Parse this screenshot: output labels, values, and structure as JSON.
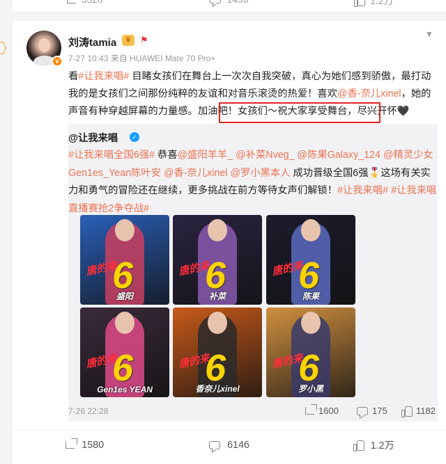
{
  "top_strip": {
    "actions": [
      {
        "icon": "share-icon",
        "count": "5320"
      },
      {
        "icon": "comment-icon",
        "count": "1496"
      },
      {
        "icon": "like-icon",
        "count": "1.2万"
      }
    ]
  },
  "post": {
    "username": "刘涛tamia",
    "meta": "7-27 10:43 来自 HUAWEI Mate 70 Pro+",
    "text_parts": {
      "p1": "看",
      "tag1": "#让我来唱#",
      "p2": " 目睹女孩们在舞台上一次次自我突破，真心为她们感到骄傲，最打动我的是女孩们之间那份纯粹的友谊和对音乐滚烫的热爱！喜欢",
      "mention1": "@香-奈儿xinel",
      "p3": "，她的声音有种穿越屏幕的力量感。",
      "p4": "加油吧！女孩们～祝大家享受舞台，尽兴开怀🖤"
    },
    "highlight_color": "#e02424"
  },
  "repost": {
    "author": "@让我来唱",
    "text_parts": {
      "tag1": "#让我来唱全国6强#",
      "p1": " 恭喜",
      "m1": "@盛阳羊羊_",
      "m2": " @补菜Nveg_",
      "m3": " @陈果Galaxy_124",
      "m4": " @精灵少女Gen1es_Yean陈叶安",
      "m5": " @香-奈儿xinel",
      "m6": " @罗小黑本人",
      "p2": " 成功晋级全国6强🎖️这场有关实力和勇气的冒险还在继续，更多挑战在前方等待女声们解锁！",
      "tag2": "#让我来唱#",
      "tag3": " #让我来唱直播赛抢2争夺战#"
    },
    "photos": [
      {
        "caption": "盛阳",
        "bg": "#2a5fb8",
        "accent": "#c94060"
      },
      {
        "caption": "补菜",
        "bg": "#2b2340",
        "accent": "#8a5ab0"
      },
      {
        "caption": "陈果",
        "bg": "#1c1c2c",
        "accent": "#5a6ac0"
      },
      {
        "caption": "Gen1es YEAN",
        "bg": "#3a2a3a",
        "accent": "#e04a8a"
      },
      {
        "caption": "香奈儿xinel",
        "bg": "#c85a1a",
        "accent": "#2a2a2a"
      },
      {
        "caption": "罗小黑",
        "bg": "#d09040",
        "accent": "#3a3a6a"
      }
    ],
    "photo_overlay_number": "6",
    "photo_overlay_script": "唐的来",
    "time": "7-26 22:28",
    "shares": "1600",
    "comments": "175",
    "likes": "1182"
  },
  "actions": {
    "shares": "1580",
    "comments": "6146",
    "likes": "1.2万"
  },
  "colors": {
    "link": "#eb7350",
    "verify_orange": "#ff8200",
    "verify_blue": "#1a9cff"
  }
}
